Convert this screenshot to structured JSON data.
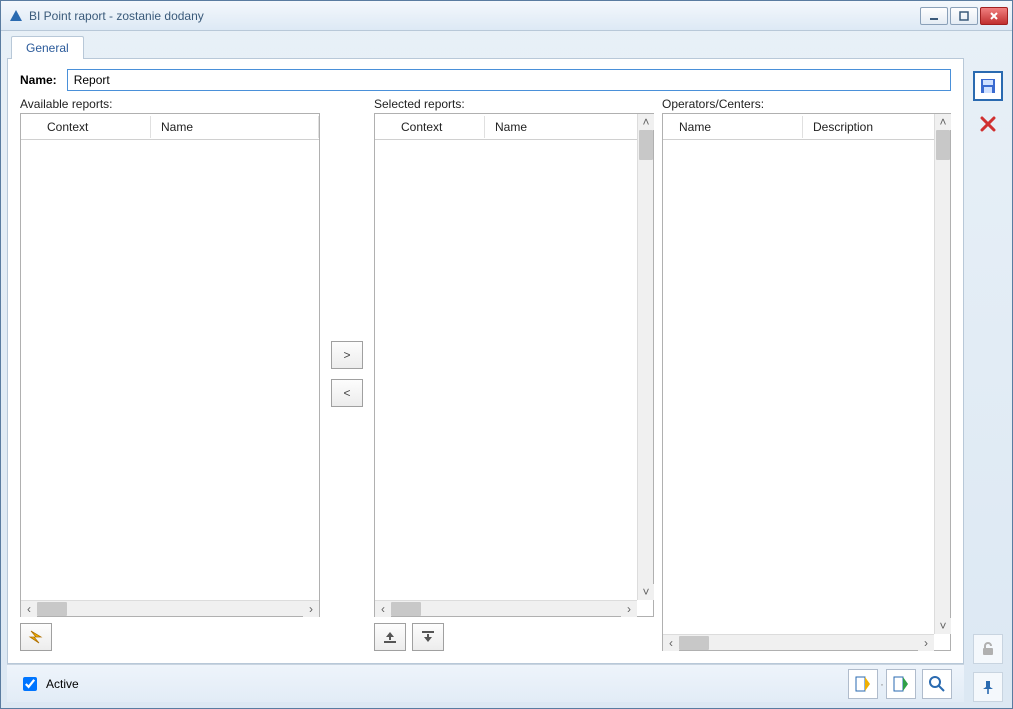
{
  "window": {
    "title": "BI Point raport  - zostanie dodany"
  },
  "tabs": {
    "general": "General"
  },
  "form": {
    "name_label": "Name:",
    "name_value": "Report"
  },
  "sections": {
    "available_label": "Available reports:",
    "selected_label": "Selected reports:",
    "operators_label": "Operators/Centers:"
  },
  "columns": {
    "context": "Context",
    "name": "Name",
    "op_name": "Name",
    "op_description": "Description"
  },
  "buttons": {
    "move_right": ">",
    "move_left": "<"
  },
  "footer": {
    "active_label": "Active",
    "active_checked": true
  },
  "icons": {
    "save": "save",
    "delete": "delete",
    "lightning": "refresh",
    "upload": "upload",
    "download": "download",
    "unlock": "unlock",
    "pin": "pin",
    "apply_up": "apply-changes",
    "apply_down": "apply-close",
    "search": "search"
  }
}
